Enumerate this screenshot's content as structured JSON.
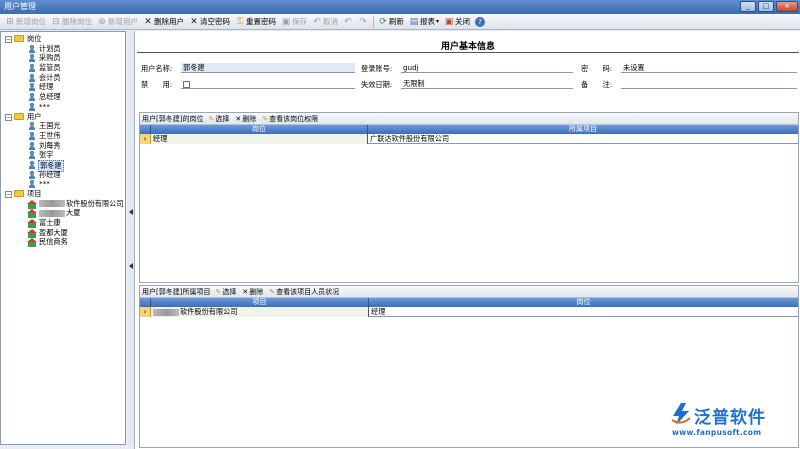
{
  "window": {
    "title": "用户管理",
    "controls": [
      "_",
      "□",
      "×"
    ]
  },
  "toolbar": [
    {
      "label": "新增岗位",
      "icon": "add-post-icon",
      "enabled": false
    },
    {
      "label": "删除岗位",
      "icon": "delete-post-icon",
      "enabled": false
    },
    {
      "label": "新增用户",
      "icon": "add-user-icon",
      "enabled": false
    },
    {
      "label": "删除用户",
      "icon": "delete-user-icon",
      "enabled": true
    },
    {
      "label": "清空密码",
      "icon": "clear-password-icon",
      "enabled": true
    },
    {
      "label": "重置密码",
      "icon": "reset-password-icon",
      "enabled": true
    },
    {
      "label": "保存",
      "icon": "save-icon",
      "enabled": false
    },
    {
      "label": "取消",
      "icon": "cancel-icon",
      "enabled": false
    },
    {
      "label": "刷新",
      "icon": "refresh-icon",
      "enabled": true
    },
    {
      "label": "报表",
      "icon": "report-icon",
      "enabled": true
    },
    {
      "label": "关闭",
      "icon": "close-icon",
      "enabled": true
    }
  ],
  "tree": {
    "posts_root": "岗位",
    "posts": [
      "计划员",
      "采购员",
      "监管员",
      "会计员",
      "经理",
      "总经理",
      "***"
    ],
    "users_root": "用户",
    "users": [
      "王国光",
      "王世伟",
      "刘每秀",
      "张宇",
      "郭冬建",
      "孙经理",
      "***"
    ],
    "selected_user": "郭冬建",
    "projects_root": "项目",
    "projects": [
      "软件股份有限公司",
      "大厦",
      "富士康",
      "盈都大厦",
      "民信商务"
    ]
  },
  "info": {
    "title": "用户基本信息",
    "name_label": "用户名称:",
    "name_value": "郭冬建",
    "account_label": "登录账号:",
    "account_value": "gudj",
    "password_label": "密　　码:",
    "password_value": "未设置",
    "disabled_label": "禁　　用:",
    "expiry_label": "失效日期:",
    "expiry_value": "无限制",
    "remark_label": "备　　注:",
    "remark_value": ""
  },
  "posts_grid": {
    "caption": "用户[郭冬建]的岗位",
    "actions": [
      "选择",
      "删除",
      "查看该岗位权限"
    ],
    "columns": [
      "岗位",
      "所属项目"
    ],
    "rows": [
      {
        "indicator": "›",
        "post": "经理",
        "project": "广联达软件股份有限公司"
      }
    ]
  },
  "projects_grid": {
    "caption": "用户[郭冬建]所属项目",
    "actions": [
      "选择",
      "删除",
      "查看该项目人员状况"
    ],
    "columns": [
      "项目",
      "岗位"
    ],
    "rows": [
      {
        "indicator": "›",
        "project": "软件股份有限公司",
        "post": "经理"
      }
    ]
  },
  "logo": {
    "name": "泛普软件",
    "url": "www.fanpusoft.com"
  },
  "colors": {
    "accent": "#3c6fb8",
    "grid_header": "#4f80c6",
    "indicator": "#f7d57a",
    "logo": "#1f6fcf"
  }
}
